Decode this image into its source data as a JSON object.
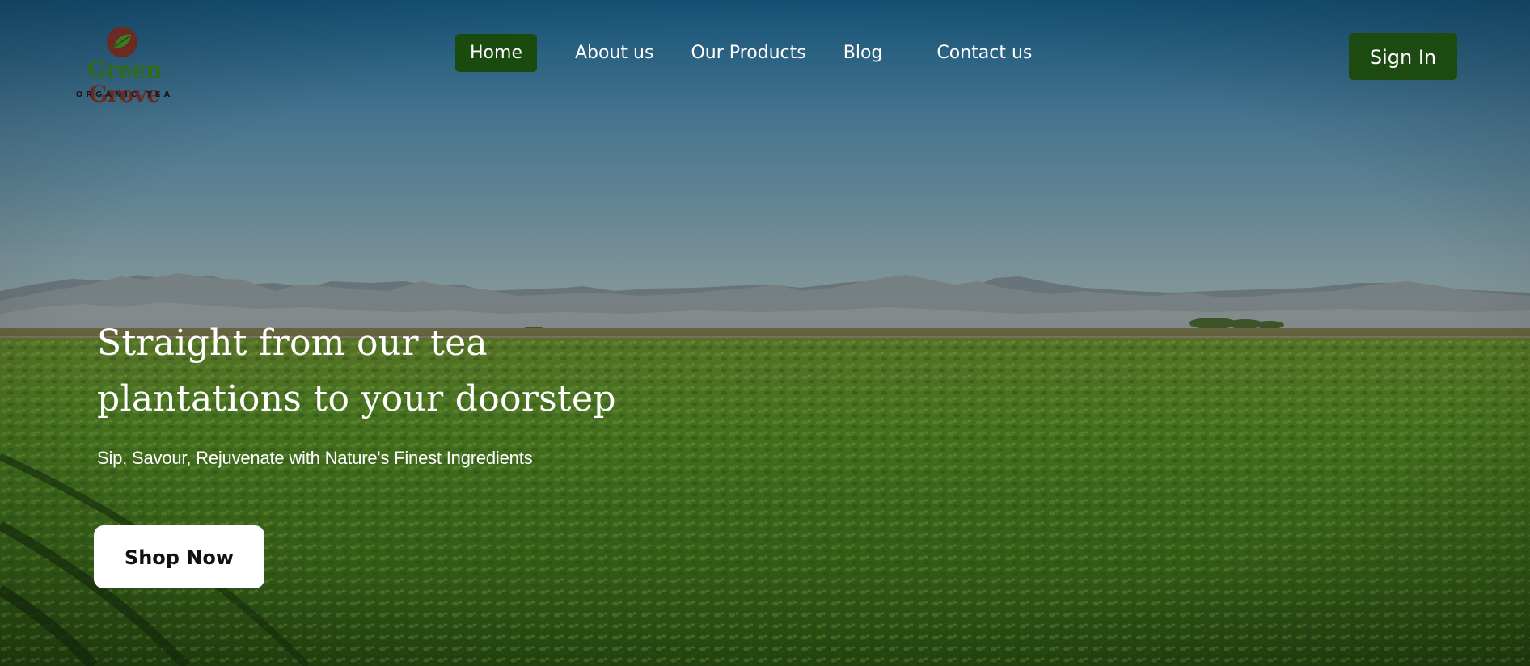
{
  "brand": {
    "name_part1": "Green",
    "name_part2": "Grove",
    "tagline": "ORGANIC TEA",
    "logo_icon": "leaf-icon",
    "primary_color": "#1b4a0f"
  },
  "nav": {
    "items": [
      {
        "label": "Home",
        "active": true
      },
      {
        "label": "About us",
        "active": false
      },
      {
        "label": "Our Products",
        "active": false
      },
      {
        "label": "Blog",
        "active": false
      },
      {
        "label": "Contact us",
        "active": false
      }
    ],
    "sign_in_label": "Sign In"
  },
  "hero": {
    "headline_line1": "Straight from our tea",
    "headline_line2": "plantations to your doorstep",
    "subtitle": "Sip, Savour, Rejuvenate with Nature's Finest Ingredients",
    "cta_label": "Shop Now",
    "background": "green field with mountains under blue sky"
  }
}
